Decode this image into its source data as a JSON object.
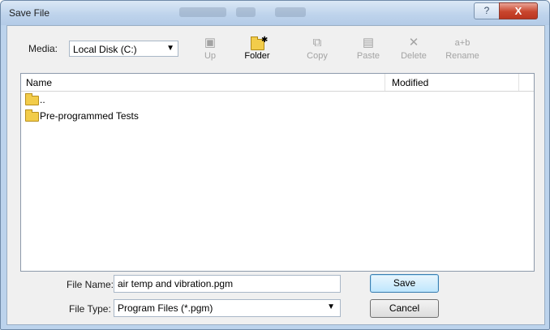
{
  "window": {
    "title": "Save File",
    "help_label": "?",
    "close_label": "X"
  },
  "media": {
    "label": "Media:",
    "value": "Local Disk (C:)"
  },
  "toolbar": {
    "up": "Up",
    "folder": "Folder",
    "copy": "Copy",
    "paste": "Paste",
    "delete": "Delete",
    "rename": "Rename",
    "rename_glyph": "a+b",
    "delete_glyph": "✕"
  },
  "list": {
    "columns": {
      "name": "Name",
      "modified": "Modified"
    },
    "rows": [
      {
        "name": "..",
        "icon": "folder-icon"
      },
      {
        "name": "Pre-programmed Tests",
        "icon": "folder-icon"
      }
    ]
  },
  "form": {
    "file_name_label": "File Name:",
    "file_name_value": "air temp and vibration.pgm",
    "file_type_label": "File Type:",
    "file_type_value": "Program Files (*.pgm)",
    "save_label": "Save",
    "cancel_label": "Cancel"
  }
}
